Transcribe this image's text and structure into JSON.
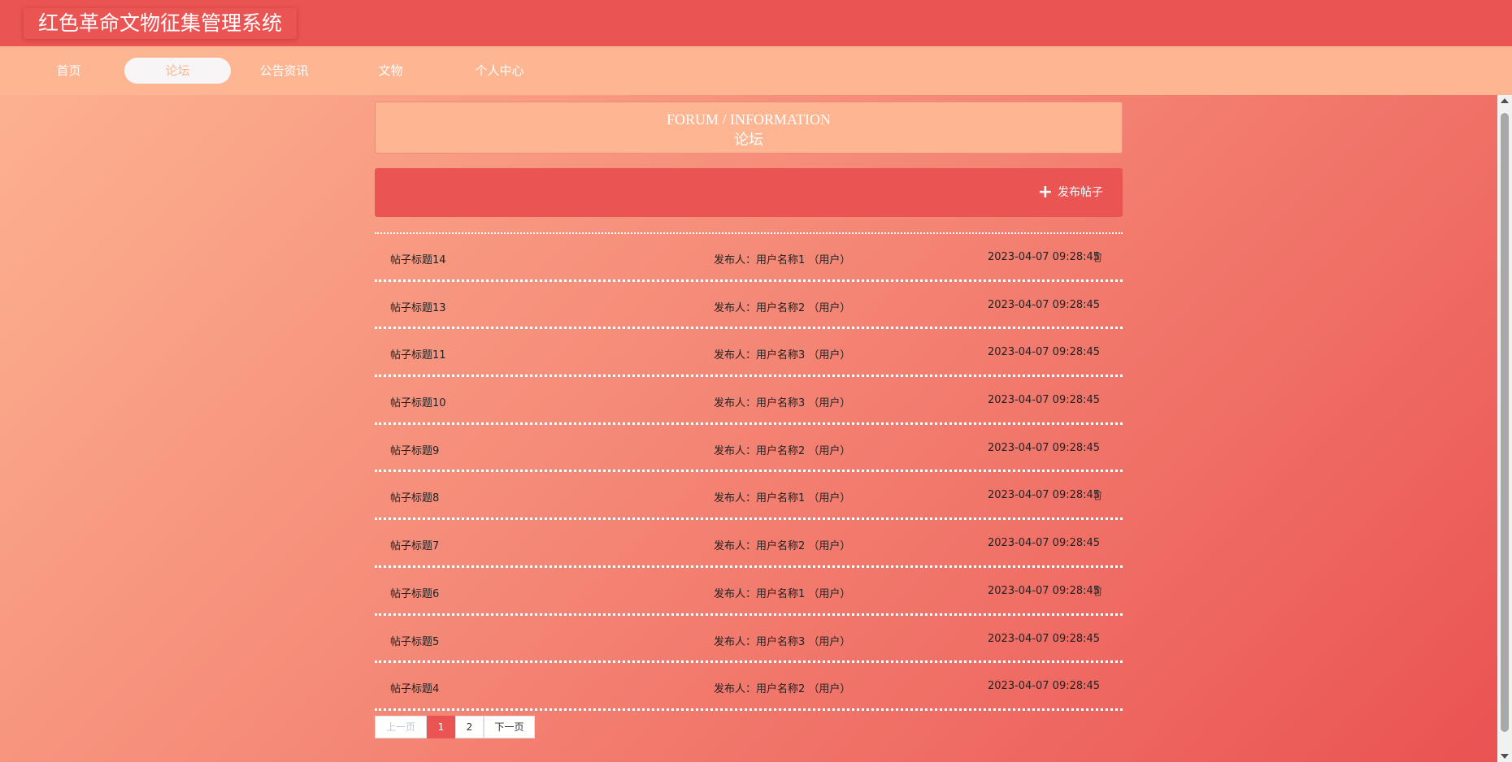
{
  "app": {
    "title": "红色革命文物征集管理系统"
  },
  "nav": {
    "items": [
      {
        "label": "首页",
        "active": false
      },
      {
        "label": "论坛",
        "active": true
      },
      {
        "label": "公告资讯",
        "active": false
      },
      {
        "label": "文物",
        "active": false
      },
      {
        "label": "个人中心",
        "active": false
      }
    ]
  },
  "section": {
    "title_en": "FORUM / INFORMATION",
    "title_cn": "论坛"
  },
  "actions": {
    "publish_label": "发布帖子",
    "publish_icon": "plus-icon"
  },
  "posts": [
    {
      "title": "帖子标题14",
      "author": "发布人：用户名称1 （用户）",
      "time": "2023-04-07 09:28:45",
      "deletable": true
    },
    {
      "title": "帖子标题13",
      "author": "发布人：用户名称2 （用户）",
      "time": "2023-04-07 09:28:45",
      "deletable": false
    },
    {
      "title": "帖子标题11",
      "author": "发布人：用户名称3 （用户）",
      "time": "2023-04-07 09:28:45",
      "deletable": false
    },
    {
      "title": "帖子标题10",
      "author": "发布人：用户名称3 （用户）",
      "time": "2023-04-07 09:28:45",
      "deletable": false
    },
    {
      "title": "帖子标题9",
      "author": "发布人：用户名称2 （用户）",
      "time": "2023-04-07 09:28:45",
      "deletable": false
    },
    {
      "title": "帖子标题8",
      "author": "发布人：用户名称1 （用户）",
      "time": "2023-04-07 09:28:45",
      "deletable": true
    },
    {
      "title": "帖子标题7",
      "author": "发布人：用户名称2 （用户）",
      "time": "2023-04-07 09:28:45",
      "deletable": false
    },
    {
      "title": "帖子标题6",
      "author": "发布人：用户名称1 （用户）",
      "time": "2023-04-07 09:28:45",
      "deletable": true
    },
    {
      "title": "帖子标题5",
      "author": "发布人：用户名称3 （用户）",
      "time": "2023-04-07 09:28:45",
      "deletable": false
    },
    {
      "title": "帖子标题4",
      "author": "发布人：用户名称2 （用户）",
      "time": "2023-04-07 09:28:45",
      "deletable": false
    }
  ],
  "pagination": {
    "prev_label": "上一页",
    "pages": [
      "1",
      "2"
    ],
    "current": "1",
    "next_label": "下一页"
  },
  "colors": {
    "primary": "#ea5453",
    "secondary": "#feb591"
  }
}
